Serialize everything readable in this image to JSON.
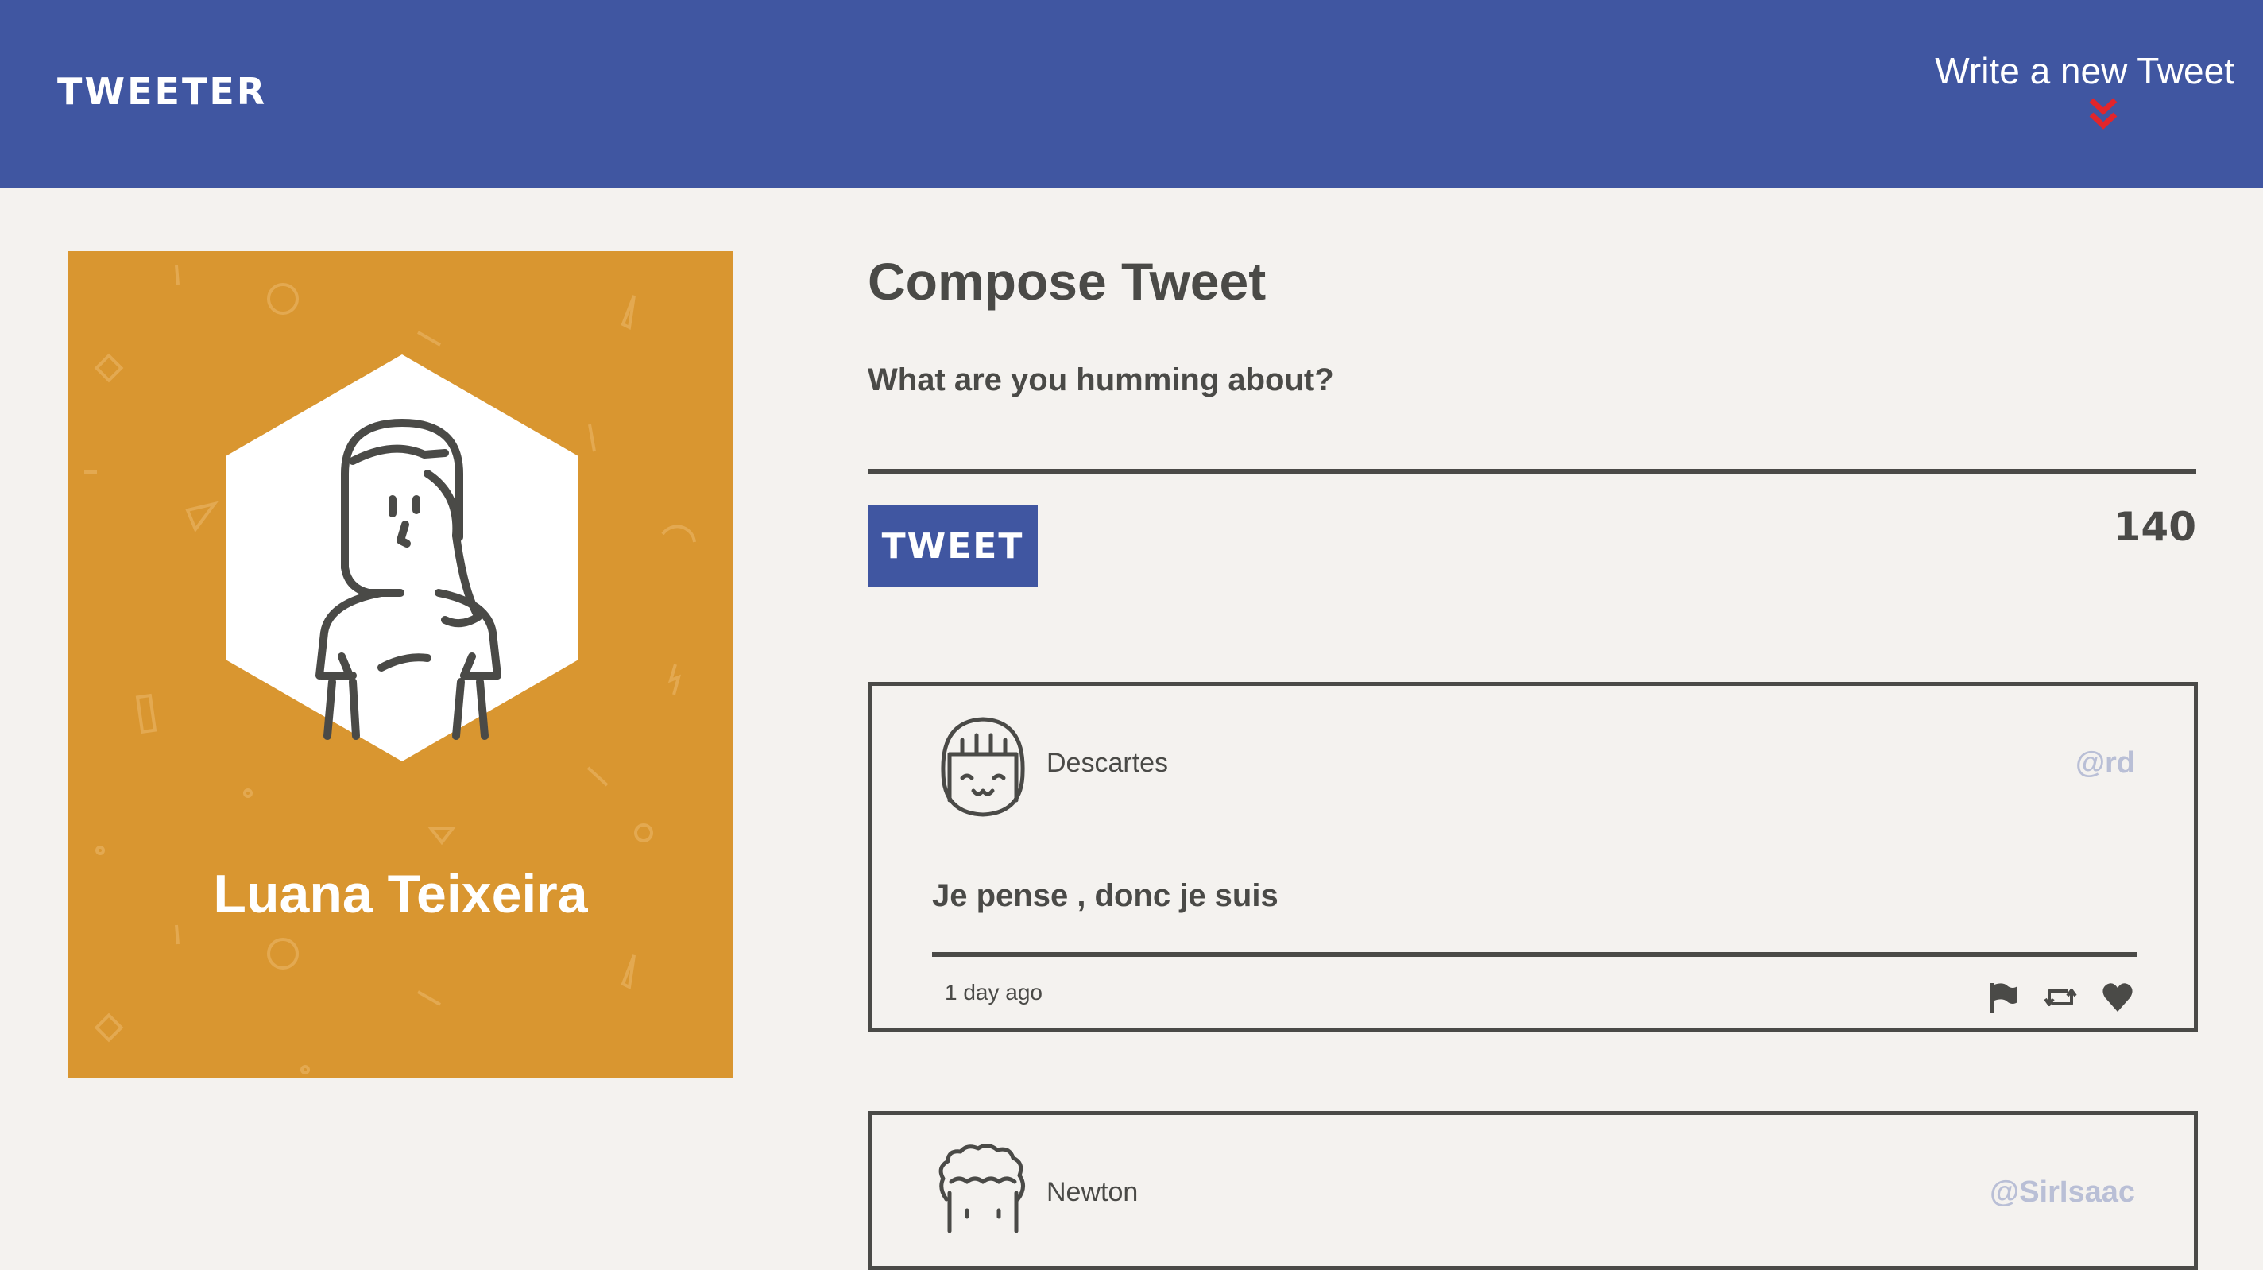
{
  "header": {
    "brand": "TWEETER",
    "compose_toggle_label": "Write a new Tweet",
    "compose_toggle_icon": "double-chevron-down-icon",
    "accent_color": "#e2252b",
    "bar_color": "#4056a1"
  },
  "profile": {
    "name": "Luana Teixeira",
    "avatar_icon": "user-avatar-hexagon",
    "card_color": "#d99630"
  },
  "composer": {
    "title": "Compose Tweet",
    "placeholder": "What are you humming about?",
    "button_label": "TWEET",
    "char_count": "140"
  },
  "tweets": [
    {
      "name": "Descartes",
      "handle": "@rd",
      "body": "Je pense , donc je suis",
      "time": "1 day ago",
      "avatar_icon": "descartes-avatar",
      "actions": [
        "flag-icon",
        "retweet-icon",
        "heart-icon"
      ]
    },
    {
      "name": "Newton",
      "handle": "@SirIsaac",
      "avatar_icon": "newton-avatar"
    }
  ]
}
